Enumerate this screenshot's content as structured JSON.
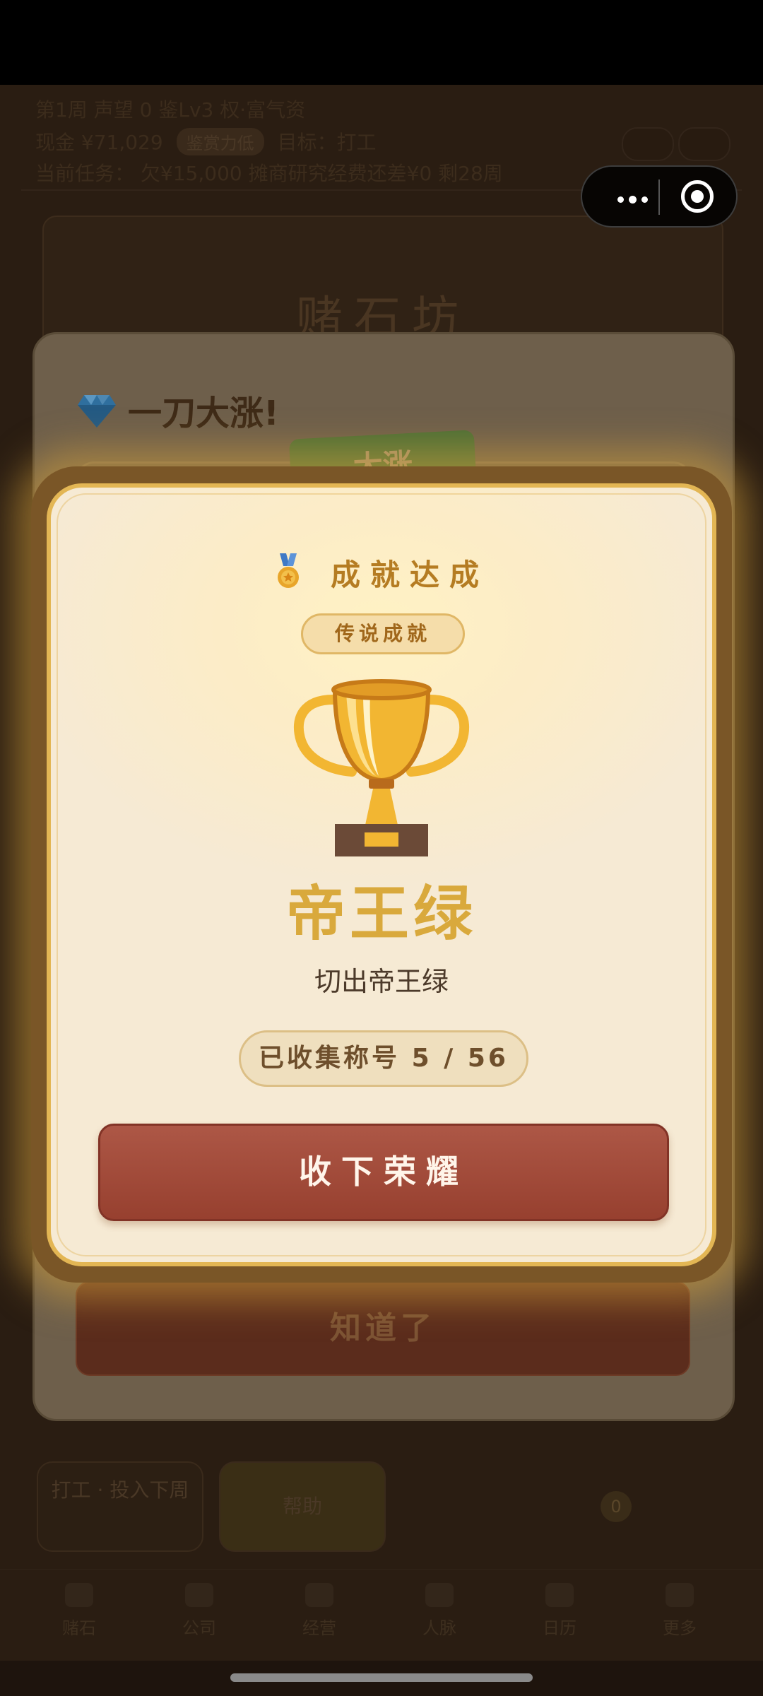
{
  "hud": {
    "week": "第1周",
    "reputation": "声望 0",
    "level": "鉴Lv3",
    "perk": "权·富气资",
    "cash": "现金 ¥71,029",
    "status_chip": "鉴赏力低",
    "target": "目标：打工",
    "task": "当前任务：",
    "debt": "欠¥15,000",
    "note": "摊商研究经费还差¥0",
    "days_left": "剩28周"
  },
  "store": {
    "title": "赌石坊"
  },
  "modal_bg": {
    "header": "一刀大涨!",
    "tag": "大涨",
    "button": "知道了"
  },
  "achievement": {
    "header": "成就达成",
    "rarity": "传说成就",
    "title": "帝王绿",
    "description": "切出帝王绿",
    "progress": "已收集称号 5 / 56",
    "accept_button": "收下荣耀"
  },
  "actions": {
    "work": "打工 · 投入下周",
    "help": "帮助",
    "badge_count": "0"
  },
  "tabs": [
    "赌石",
    "公司",
    "经营",
    "人脉",
    "日历",
    "更多"
  ],
  "colors": {
    "accent_gold": "#d9a93c",
    "button_red": "#a24a39",
    "card_bg": "#f8ecd1"
  },
  "icons": [
    "more-dots-icon",
    "target-circle-icon",
    "gem-icon",
    "medal-icon",
    "trophy-icon"
  ]
}
